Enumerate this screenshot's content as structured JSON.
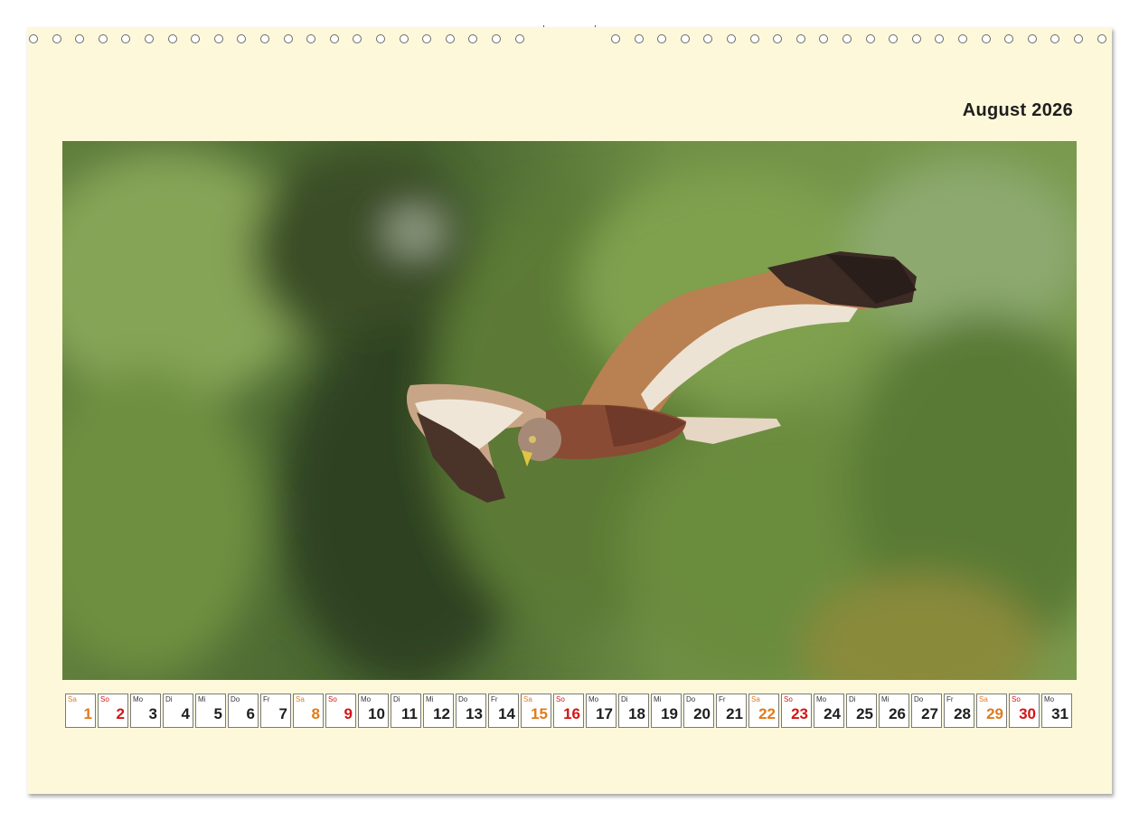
{
  "calendar": {
    "title": "August 2026",
    "photo_subject": "bird-in-flight-photo",
    "colors": {
      "paper": "#fdf8d9",
      "saturday": "#e07b1a",
      "sunday": "#d41414",
      "weekday": "#1e1e1e"
    },
    "days": [
      {
        "wd": "Sa",
        "n": "1",
        "type": "sat"
      },
      {
        "wd": "So",
        "n": "2",
        "type": "sun"
      },
      {
        "wd": "Mo",
        "n": "3",
        "type": "wk"
      },
      {
        "wd": "Di",
        "n": "4",
        "type": "wk"
      },
      {
        "wd": "Mi",
        "n": "5",
        "type": "wk"
      },
      {
        "wd": "Do",
        "n": "6",
        "type": "wk"
      },
      {
        "wd": "Fr",
        "n": "7",
        "type": "wk"
      },
      {
        "wd": "Sa",
        "n": "8",
        "type": "sat"
      },
      {
        "wd": "So",
        "n": "9",
        "type": "sun"
      },
      {
        "wd": "Mo",
        "n": "10",
        "type": "wk"
      },
      {
        "wd": "Di",
        "n": "11",
        "type": "wk"
      },
      {
        "wd": "Mi",
        "n": "12",
        "type": "wk"
      },
      {
        "wd": "Do",
        "n": "13",
        "type": "wk"
      },
      {
        "wd": "Fr",
        "n": "14",
        "type": "wk"
      },
      {
        "wd": "Sa",
        "n": "15",
        "type": "sat"
      },
      {
        "wd": "So",
        "n": "16",
        "type": "sun"
      },
      {
        "wd": "Mo",
        "n": "17",
        "type": "wk"
      },
      {
        "wd": "Di",
        "n": "18",
        "type": "wk"
      },
      {
        "wd": "Mi",
        "n": "19",
        "type": "wk"
      },
      {
        "wd": "Do",
        "n": "20",
        "type": "wk"
      },
      {
        "wd": "Fr",
        "n": "21",
        "type": "wk"
      },
      {
        "wd": "Sa",
        "n": "22",
        "type": "sat"
      },
      {
        "wd": "So",
        "n": "23",
        "type": "sun"
      },
      {
        "wd": "Mo",
        "n": "24",
        "type": "wk"
      },
      {
        "wd": "Di",
        "n": "25",
        "type": "wk"
      },
      {
        "wd": "Mi",
        "n": "26",
        "type": "wk"
      },
      {
        "wd": "Do",
        "n": "27",
        "type": "wk"
      },
      {
        "wd": "Fr",
        "n": "28",
        "type": "wk"
      },
      {
        "wd": "Sa",
        "n": "29",
        "type": "sat"
      },
      {
        "wd": "So",
        "n": "30",
        "type": "sun"
      },
      {
        "wd": "Mo",
        "n": "31",
        "type": "wk"
      }
    ]
  }
}
